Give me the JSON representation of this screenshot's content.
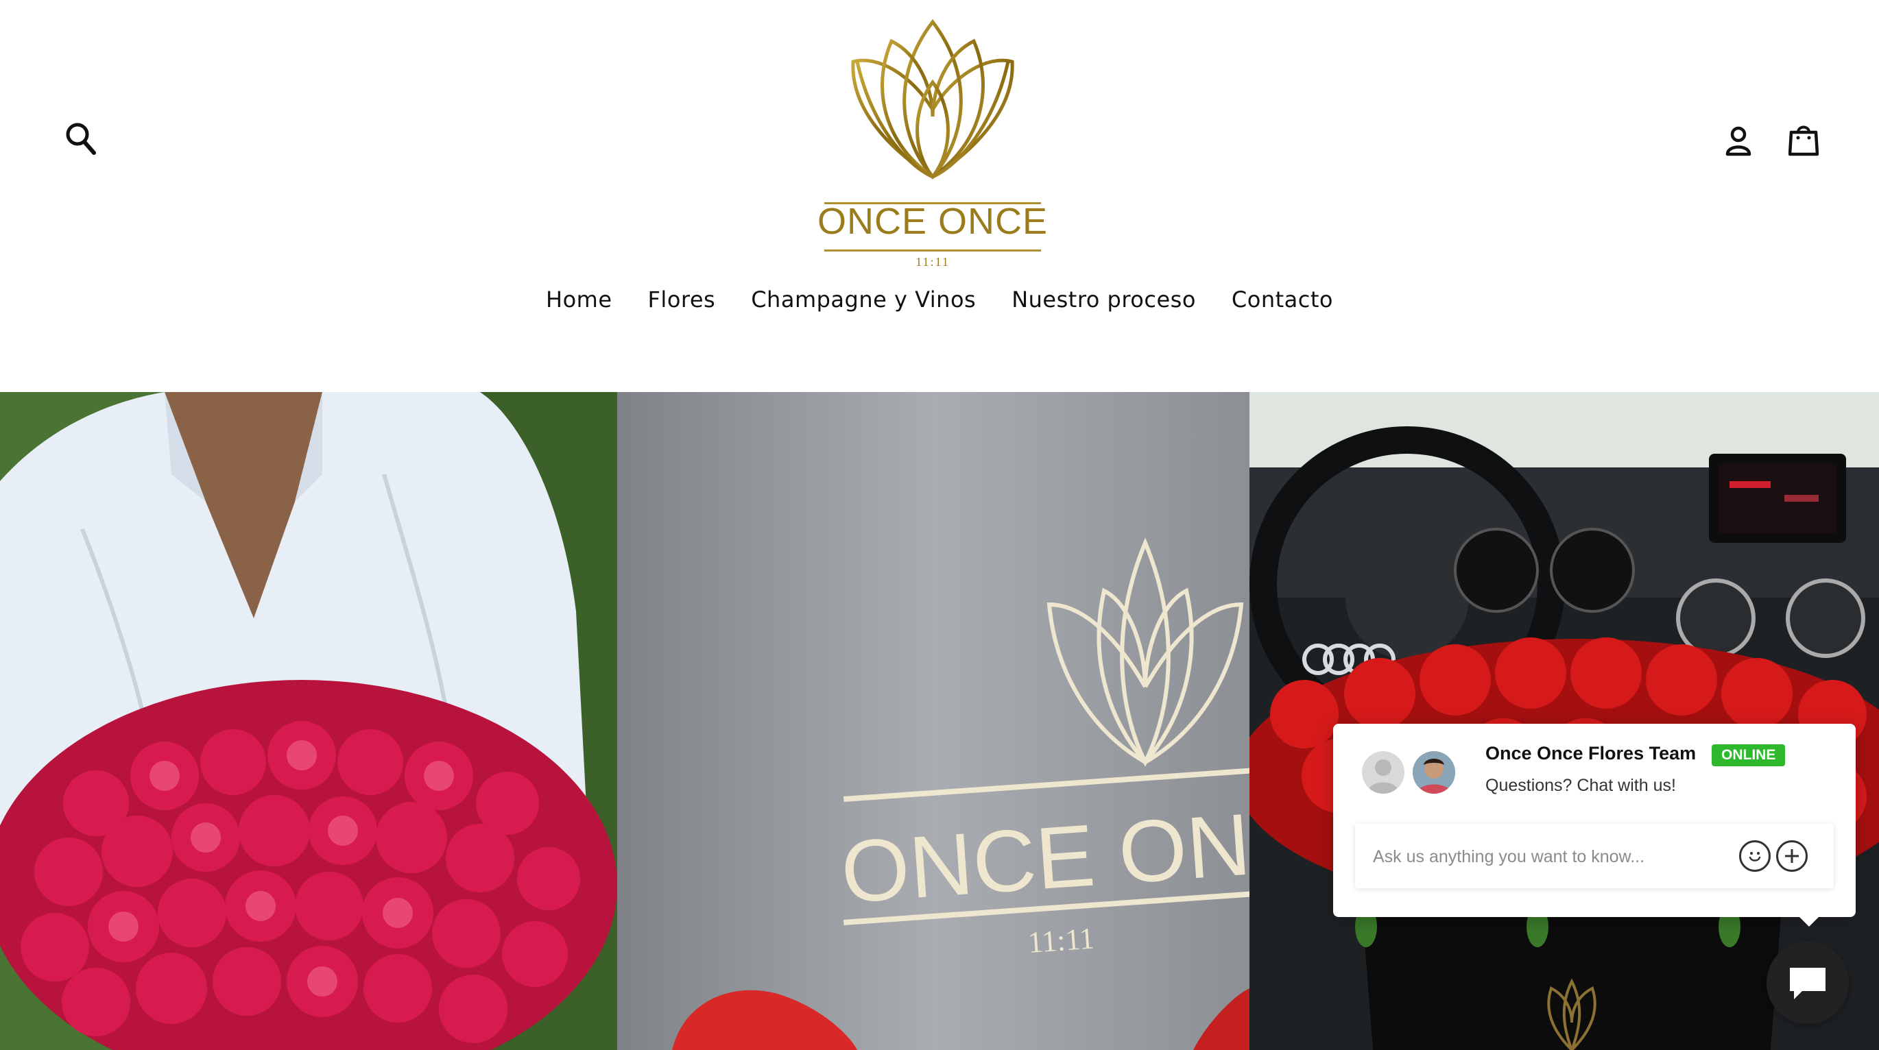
{
  "header": {
    "logo": {
      "name": "ONCE ONCE",
      "subtitle": "11:11"
    },
    "icons": {
      "search": "search-icon",
      "account": "user-icon",
      "cart": "shopping-bag-icon"
    }
  },
  "nav": {
    "items": [
      {
        "label": "Home"
      },
      {
        "label": "Flores"
      },
      {
        "label": "Champagne y Vinos"
      },
      {
        "label": "Nuestro proceso"
      },
      {
        "label": "Contacto"
      }
    ]
  },
  "hero": {
    "panels": [
      {
        "icon": "man-holding-pink-roses-photo"
      },
      {
        "icon": "once-once-gift-box-photo",
        "box_text": "ONCE ON",
        "box_subtitle": "11:11"
      },
      {
        "icon": "red-roses-in-car-photo"
      }
    ]
  },
  "chat": {
    "team_name": "Once Once Flores Team",
    "status": "ONLINE",
    "tagline": "Questions? Chat with us!",
    "input_placeholder": "Ask us anything you want to know...",
    "status_color": "#2eb82e",
    "icons": {
      "emoji": "smiley-icon",
      "attach": "plus-icon",
      "launcher": "chat-bubble-icon"
    }
  },
  "colors": {
    "brand_gold": "#9a7c1c",
    "text": "#111111",
    "background": "#ffffff"
  }
}
